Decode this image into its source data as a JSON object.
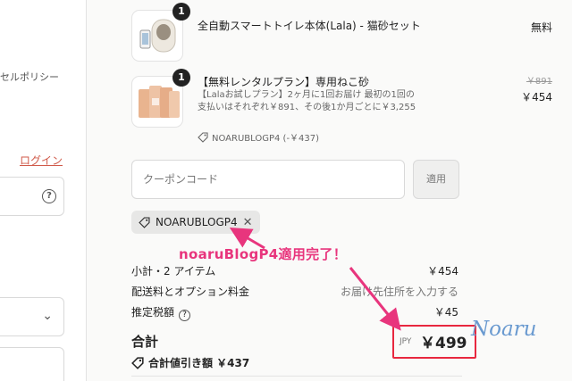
{
  "left": {
    "policy_text": "セルポリシー",
    "login_link": "ログイン"
  },
  "items": [
    {
      "qty": "1",
      "name": "全自動スマートトイレ本体(Lala) - 猫砂セット",
      "price": "無料"
    },
    {
      "qty": "1",
      "name": "【無料レンタルプラン】専用ねこ砂",
      "subtitle": "【Lalaお試しプラン】2ヶ月に1回お届け 最初の1回の支払いはそれぞれ￥891、その後1か月ごとに￥3,255",
      "discount": "NOARUBLOGP4 (-￥437)",
      "original_price": "￥891",
      "price": "￥454"
    }
  ],
  "coupon": {
    "placeholder": "クーポンコード",
    "apply_label": "適用",
    "applied_code": "NOARUBLOGP4"
  },
  "annotation": "noaruBlogP4適用完了！",
  "summary": {
    "subtotal_label": "小計・2 アイテム",
    "subtotal_value": "￥454",
    "shipping_label": "配送料とオプション料金",
    "shipping_value": "お届け先住所を入力する",
    "tax_label": "推定税額",
    "tax_value": "￥45",
    "total_label": "合計",
    "currency": "JPY",
    "total_value": "￥499",
    "total_discount": "合計値引き額 ￥437"
  },
  "watermark": "Noaru",
  "colors": {
    "accent_red": "#e8273f",
    "annotation_pink": "#e8357d",
    "login_link": "#d05a4a"
  },
  "icons": {
    "tag": "tag-icon",
    "close": "close-icon",
    "help": "help-icon",
    "info": "info-icon",
    "chevron": "chevron-down-icon"
  }
}
